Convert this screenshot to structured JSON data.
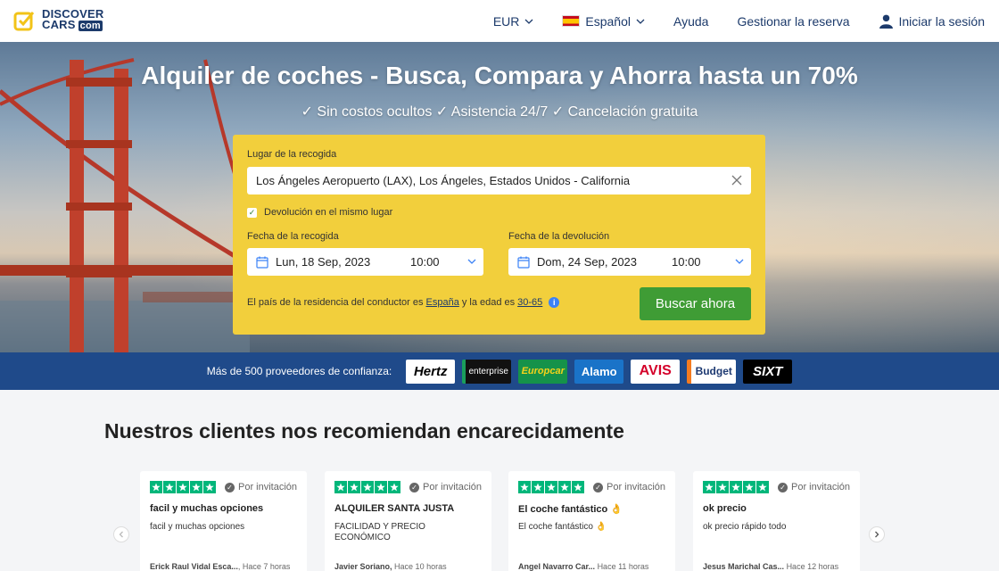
{
  "header": {
    "logo_line1": "DISCOVER",
    "logo_line2": "CARS",
    "logo_suffix": "com",
    "nav": {
      "currency": "EUR",
      "language": "Español",
      "help": "Ayuda",
      "manage": "Gestionar la reserva",
      "login": "Iniciar la sesión"
    }
  },
  "hero": {
    "title": "Alquiler de coches - Busca, Compara y Ahorra hasta un 70%",
    "subtitle": "✓ Sin costos ocultos ✓ Asistencia 24/7 ✓ Cancelación gratuita"
  },
  "search": {
    "pickup_label": "Lugar de la recogida",
    "pickup_value": "Los Ángeles Aeropuerto (LAX), Los Ángeles, Estados Unidos - California",
    "same_return_label": "Devolución en el mismo lugar",
    "pickup_date_label": "Fecha de la recogida",
    "pickup_date": "Lun, 18 Sep, 2023",
    "pickup_time": "10:00",
    "return_date_label": "Fecha de la devolución",
    "return_date": "Dom, 24 Sep, 2023",
    "return_time": "10:00",
    "residence_prefix": "El país de la residencia del conductor es",
    "residence_country": "España",
    "residence_mid": "y la edad es",
    "residence_age": "30-65",
    "search_button": "Buscar ahora"
  },
  "providers": {
    "label": "Más de 500 proveedores de confianza:",
    "logos": [
      "Hertz",
      "enterprise",
      "Europcar",
      "Alamo",
      "AVIS",
      "Budget",
      "SIXT"
    ]
  },
  "reviews": {
    "title": "Nuestros clientes nos recomiendan encarecidamente",
    "items": [
      {
        "tag": "Por invitación",
        "title": "facil y muchas opciones",
        "body": "facil y muchas opciones",
        "author": "Erick Raul Vidal Esca...",
        "time": "Hace 7 horas"
      },
      {
        "tag": "Por invitación",
        "title": "ALQUILER SANTA JUSTA",
        "body": "FACILIDAD Y PRECIO ECONÓMICO",
        "author": "Javier Soriano,",
        "time": "Hace 10 horas"
      },
      {
        "tag": "Por invitación",
        "title": "El coche fantástico 👌",
        "body": "El coche fantástico 👌",
        "author": "Angel Navarro Car...",
        "time": "Hace 11 horas"
      },
      {
        "tag": "Por invitación",
        "title": "ok precio",
        "body": "ok precio rápido todo",
        "author": "Jesus Marichal Cas...",
        "time": "Hace 12 horas"
      }
    ]
  },
  "colors": {
    "brand": "#1c3a6b",
    "search_card": "#f2cf3c",
    "cta": "#3f9c35",
    "providers_bar": "#1f4a8a",
    "trustpilot": "#00b67a"
  }
}
